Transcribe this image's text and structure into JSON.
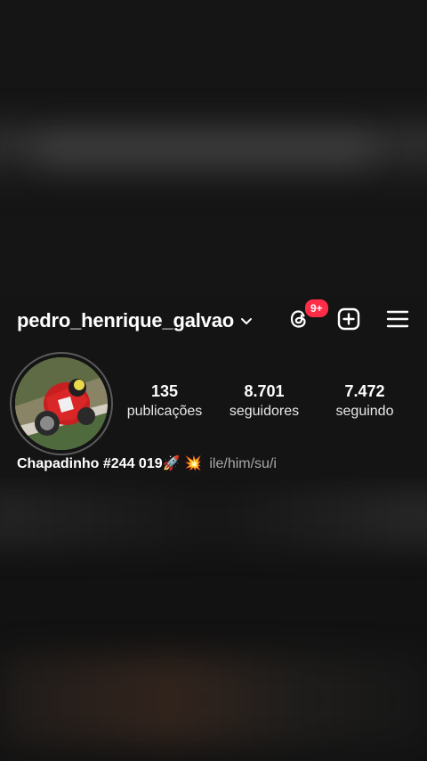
{
  "header": {
    "username": "pedro_henrique_galvao",
    "threads_badge": "9+"
  },
  "stats": {
    "posts_count": "135",
    "posts_label": "publicações",
    "followers_count": "8.701",
    "followers_label": "seguidores",
    "following_count": "7.472",
    "following_label": "seguindo"
  },
  "bio": {
    "name": "Chapadinho #244 019🚀 💥",
    "pronouns": "ile/him/su/i"
  },
  "colors": {
    "background": "#141414",
    "badge_red": "#ff2d48",
    "add_blue": "#1d8ff2"
  },
  "icons": [
    "chevron-down-icon",
    "threads-icon",
    "create-post-icon",
    "menu-icon",
    "plus-icon"
  ]
}
